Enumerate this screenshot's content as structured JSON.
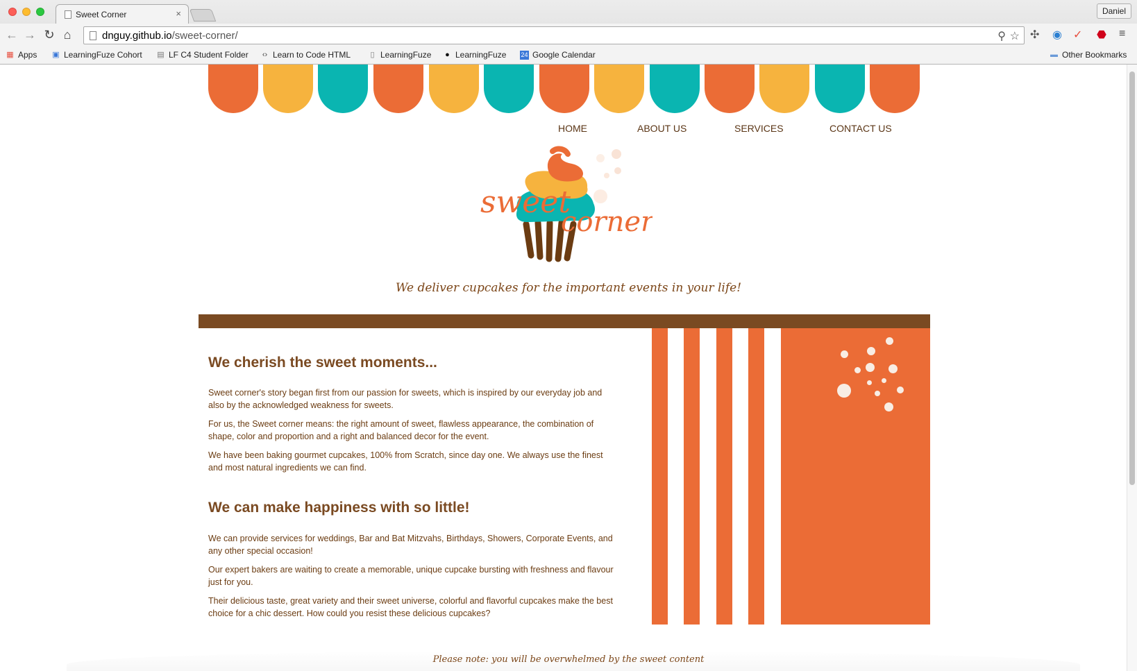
{
  "browser": {
    "tab_title": "Sweet Corner",
    "tab_close": "×",
    "profile_name": "Daniel",
    "url_host": "dnguy.github.io",
    "url_path": "/sweet-corner/",
    "bookmarks": [
      {
        "label": "Apps",
        "icon": "apps-grid-icon"
      },
      {
        "label": "LearningFuze Cohort",
        "icon": "chat-icon"
      },
      {
        "label": "LF C4 Student Folder",
        "icon": "drive-folder-icon"
      },
      {
        "label": "Learn to Code HTML",
        "icon": "code-icon"
      },
      {
        "label": "LearningFuze",
        "icon": "page-icon"
      },
      {
        "label": "LearningFuze",
        "icon": "github-icon"
      },
      {
        "label": "Google Calendar",
        "icon": "calendar-icon"
      }
    ],
    "other_bookmarks": "Other Bookmarks",
    "calendar_day": "24"
  },
  "site": {
    "nav": [
      "HOME",
      "ABOUT US",
      "SERVICES",
      "CONTACT US"
    ],
    "logo_word1": "sweet",
    "logo_word2": "corner",
    "tagline": "We deliver cupcakes for the important events in your life!",
    "section1": {
      "heading": "We cherish the sweet moments...",
      "paragraphs": [
        "Sweet corner's story began first from our passion for sweets, which is inspired by our everyday job and also by the acknowledged weakness for sweets.",
        "For us, the Sweet corner means: the right amount of sweet, flawless appearance, the combination of shape, color and proportion and a right and balanced decor for the event.",
        "We have been baking gourmet cupcakes, 100% from Scratch, since day one. We always use the finest and most natural ingredients we can find."
      ]
    },
    "section2": {
      "heading": "We can make happiness with so little!",
      "paragraphs": [
        "We can provide services for weddings, Bar and Bat Mitzvahs, Birthdays, Showers, Corporate Events, and any other special occasion!",
        "Our expert bakers are waiting to create a memorable, unique cupcake bursting with freshness and flavour just for you.",
        "Their delicious taste, great variety and their sweet universe, colorful and flavorful cupcakes make the best choice for a chic dessert. How could you resist these delicious cupcakes?"
      ]
    },
    "footer_note": "Please note: you will be overwhelmed by the sweet content"
  },
  "colors": {
    "orange": "#eb6c36",
    "yellow": "#f6b33e",
    "teal": "#0ab5b1",
    "brown": "#7a4a22"
  }
}
